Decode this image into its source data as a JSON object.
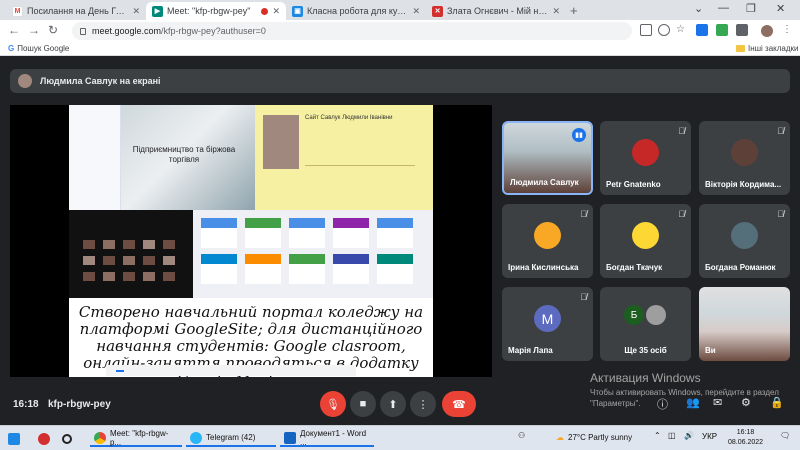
{
  "browser": {
    "tabs": [
      {
        "title": "Посилання на День Гостинності",
        "favicon": "gmail-icon",
        "active": false
      },
      {
        "title": "Meet: \"kfp-rbgw-pey\"",
        "favicon": "meet-icon",
        "active": true
      },
      {
        "title": "Класна робота для курсу \"ФБС\"",
        "favicon": "classroom-icon",
        "active": false
      },
      {
        "title": "Злата Огнєвич - Мій назавжди",
        "favicon": "youtube-icon",
        "active": false
      }
    ],
    "url_host": "meet.google.com",
    "url_path": "/kfp-rbgw-pey?authuser=0",
    "bookmarks": {
      "google": "Пошук Google",
      "other": "Інші закладки"
    }
  },
  "meet": {
    "presenter_banner": "Людмила Савлук на екрані",
    "slide": {
      "caption": "Підприємництво та біржова торгівля",
      "site_header": "Сайт Савлук Людмили Іванівни",
      "text": "Створено навчальний портал коледжу на платформі GoogleSite; для дистанційного навчання студентів: Google clasroom, онлайн-заняття проводяться в додатку Google Meet та на"
    },
    "participants": [
      {
        "name": "Людмила Савлук",
        "type": "video",
        "speaking": true
      },
      {
        "name": "Petr Gnatenko",
        "type": "avatar",
        "avatar_color": "#c62828"
      },
      {
        "name": "Вікторія Кордима...",
        "type": "avatar",
        "avatar_color": "#5d4037"
      },
      {
        "name": "Ірина Кислинська",
        "type": "avatar",
        "avatar_color": "#f9a825"
      },
      {
        "name": "Богдан Ткачук",
        "type": "avatar",
        "avatar_color": "#fdd835"
      },
      {
        "name": "Богдана Романюк",
        "type": "avatar",
        "avatar_color": "#546e7a"
      },
      {
        "name": "Марія Лапа",
        "type": "letter",
        "letter": "M",
        "avatar_color": "#5c6bc0"
      },
      {
        "name": "Ще 35 осіб",
        "type": "more",
        "letter": "Б"
      },
      {
        "name": "Ви",
        "type": "video"
      }
    ],
    "time": "16:18",
    "code": "kfp-rbgw-pey"
  },
  "windows": {
    "activate_title": "Активация Windows",
    "activate_text": "Чтобы активировать Windows, перейдите в раздел \"Параметры\".",
    "taskbar_apps": [
      {
        "label": "Meet: \"kfp-rbgw-p...",
        "icon": "chrome-icon"
      },
      {
        "label": "Telegram (42)",
        "icon": "telegram-icon"
      },
      {
        "label": "Документ1 - Word ...",
        "icon": "word-icon"
      }
    ],
    "weather": "27°C  Partly sunny",
    "lang": "УКР",
    "clock_time": "16:18",
    "clock_date": "08.06.2022"
  },
  "colors": {
    "meet_bg": "#202124",
    "tile_bg": "#3c4043",
    "end_call": "#ea4335",
    "accent": "#1a73e8"
  }
}
